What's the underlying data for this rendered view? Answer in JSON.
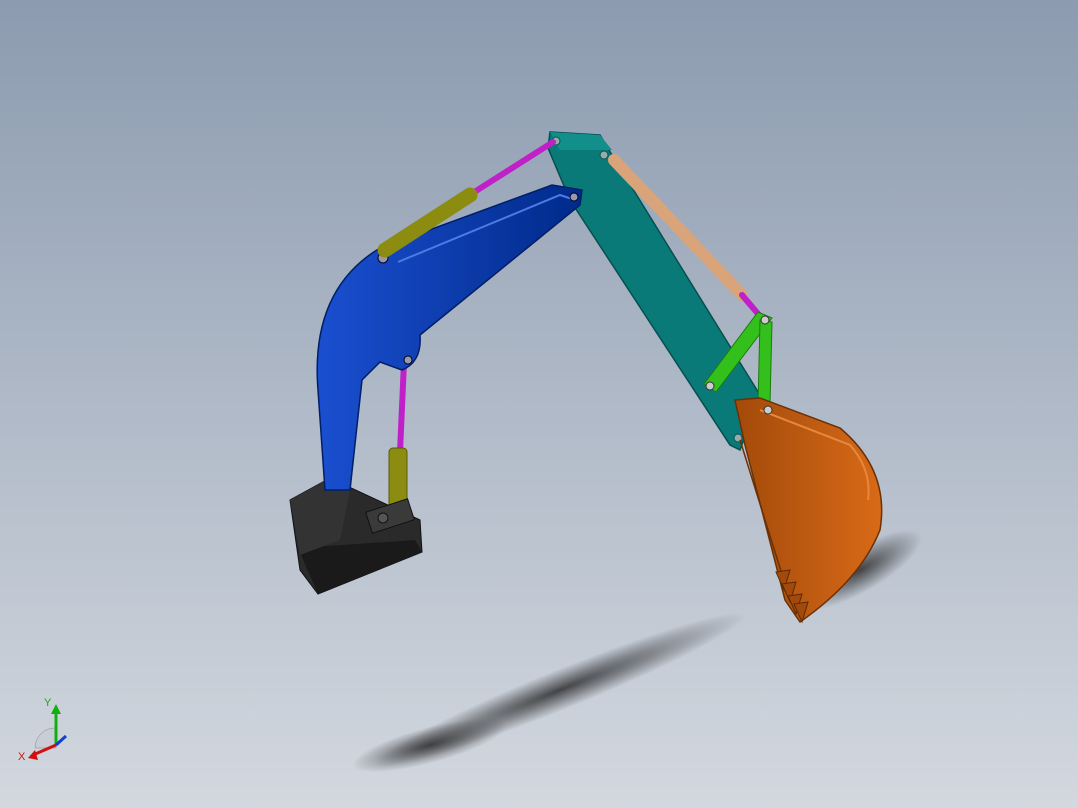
{
  "viewport": {
    "background_top": "#8c9bb0",
    "background_bottom": "#d3d8df"
  },
  "model": {
    "parts": [
      {
        "name": "base-mount",
        "color": "#222222"
      },
      {
        "name": "boom",
        "color": "#0038a8"
      },
      {
        "name": "stick",
        "color": "#0a7a78"
      },
      {
        "name": "bucket",
        "color": "#c05a10"
      },
      {
        "name": "bucket-linkage",
        "color": "#33c01c"
      },
      {
        "name": "boom-cylinder-rod",
        "color": "#c020c8"
      },
      {
        "name": "boom-cylinder-barrel",
        "color": "#8c8c10"
      },
      {
        "name": "bucket-cylinder-barrel",
        "color": "#d9a47a"
      }
    ]
  },
  "triad": {
    "x_label": "X",
    "y_label": "Y",
    "x_color": "#d01010",
    "y_color": "#10b010",
    "z_color": "#1040d0"
  }
}
